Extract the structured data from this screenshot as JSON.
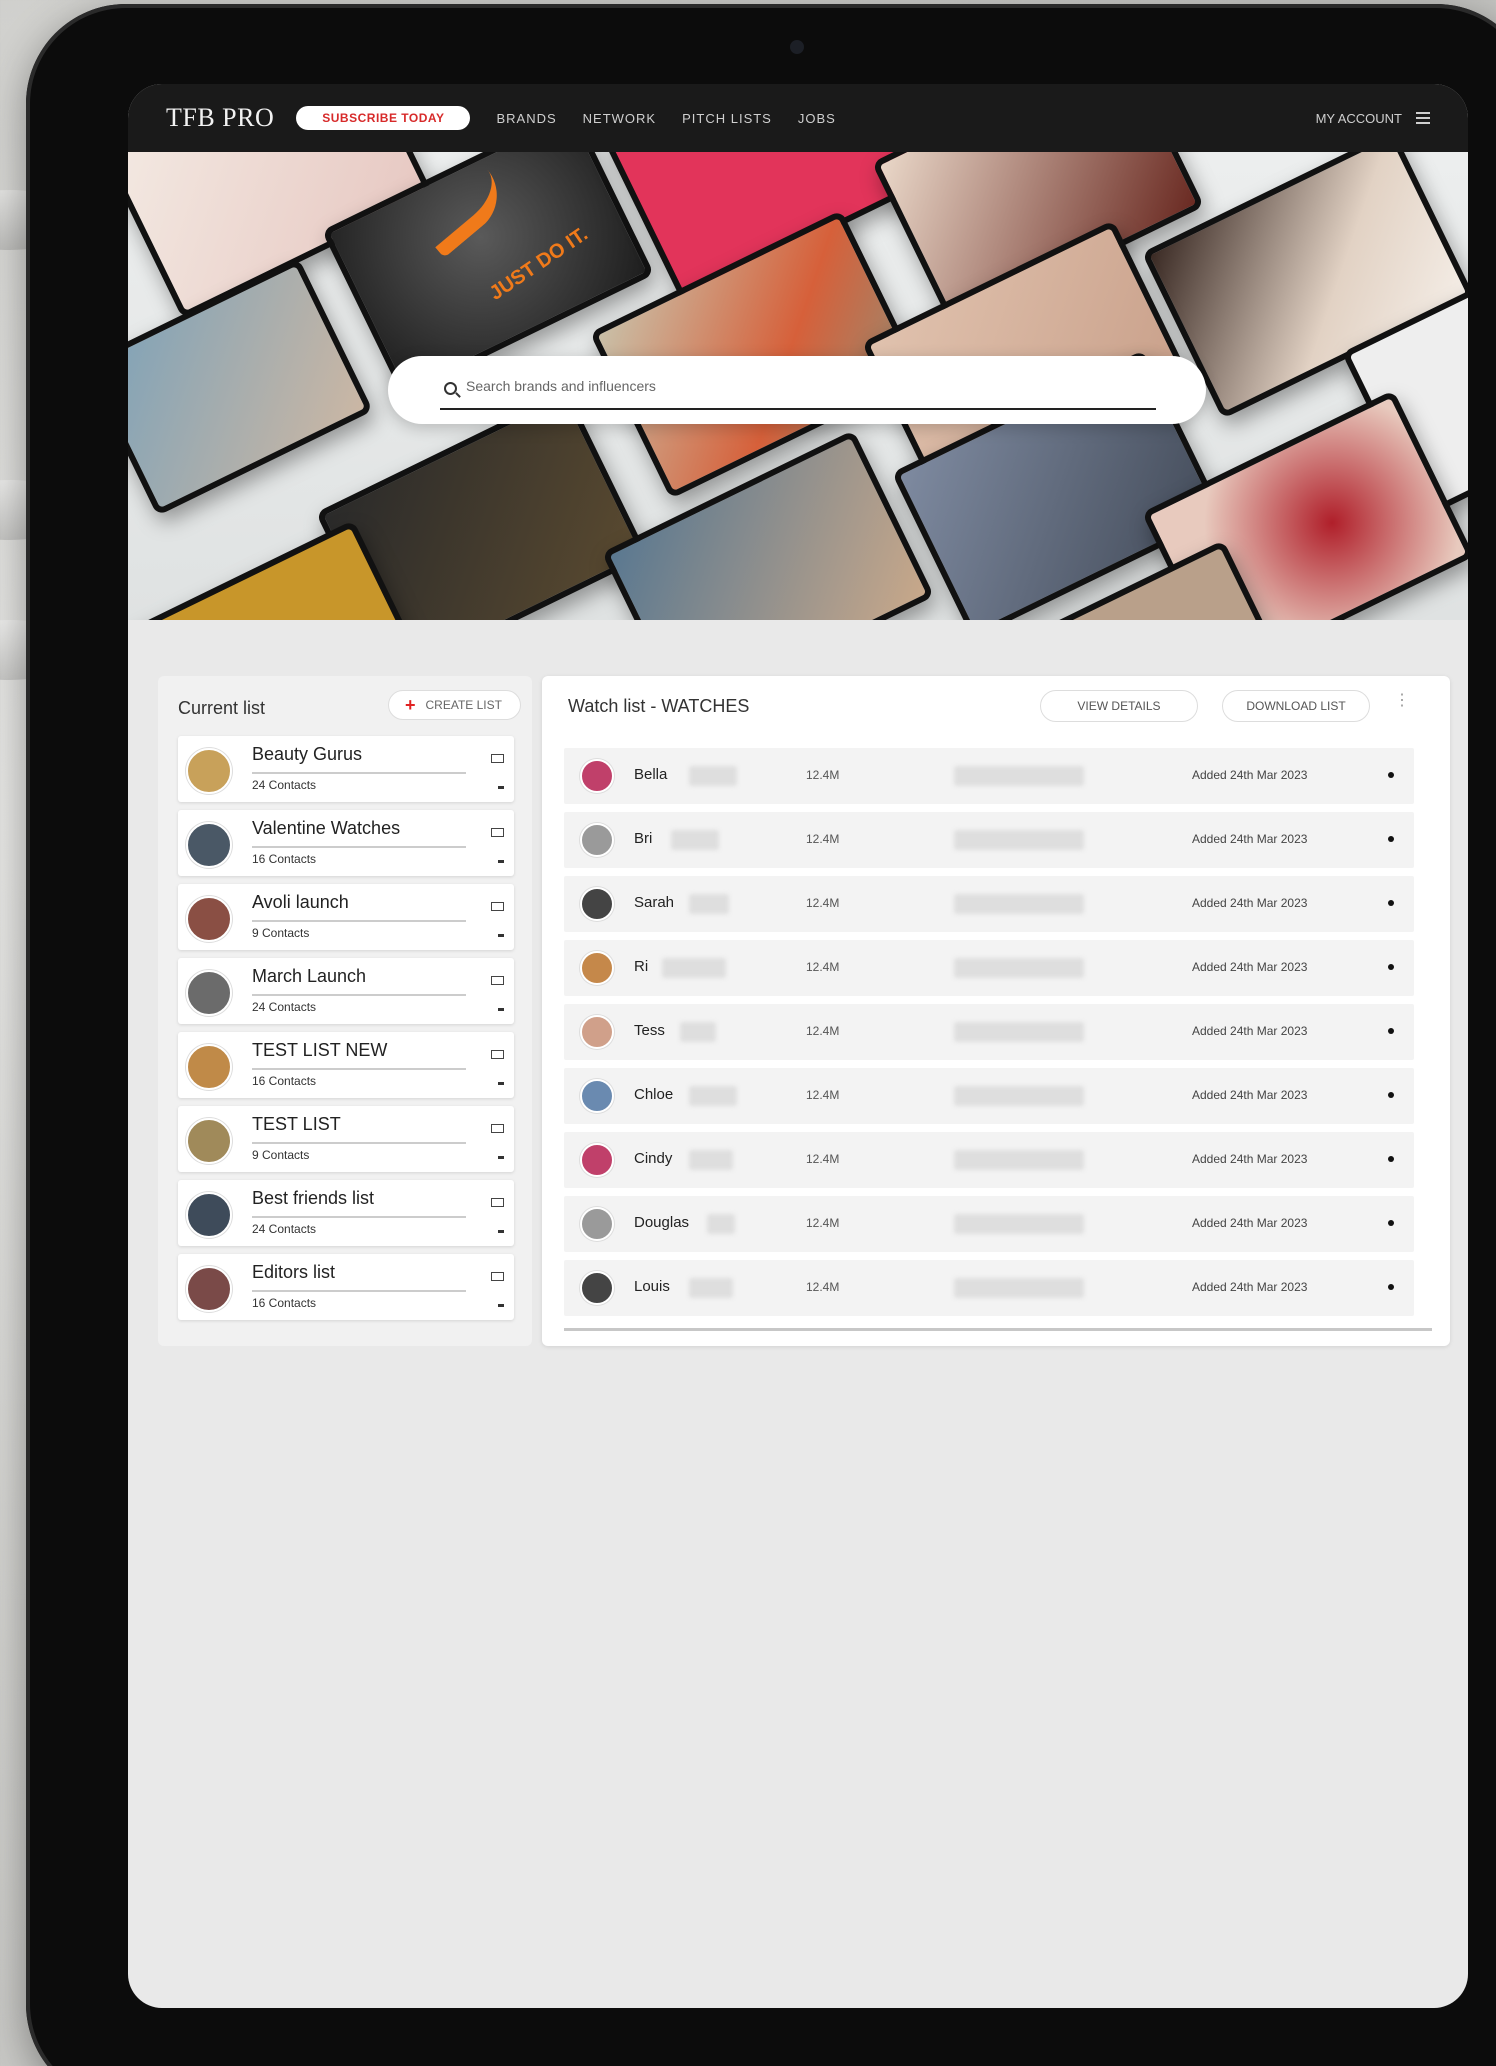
{
  "nav": {
    "logo": "TFB PRO",
    "subscribe_label": "SUBSCRIBE TODAY",
    "links": [
      "BRANDS",
      "NETWORK",
      "PITCH LISTS",
      "JOBS"
    ],
    "account_label": "MY ACCOUNT"
  },
  "search": {
    "placeholder": "Search brands and influencers"
  },
  "left_panel": {
    "title": "Current list",
    "create_label": "CREATE LIST",
    "lists": [
      {
        "name": "Beauty Gurus",
        "subtitle": "24 Contacts",
        "avatar_color": "#c8a15a"
      },
      {
        "name": "Valentine Watches",
        "subtitle": "16 Contacts",
        "avatar_color": "#4a5866"
      },
      {
        "name": "Avoli launch",
        "subtitle": "9 Contacts",
        "avatar_color": "#8a4f44"
      },
      {
        "name": "March Launch",
        "subtitle": "24 Contacts",
        "avatar_color": "#6b6b6b"
      },
      {
        "name": "TEST LIST NEW",
        "subtitle": "16 Contacts",
        "avatar_color": "#c08a48"
      },
      {
        "name": "TEST LIST",
        "subtitle": "9 Contacts",
        "avatar_color": "#a08a5a"
      },
      {
        "name": "Best friends list",
        "subtitle": "24 Contacts",
        "avatar_color": "#3e4b5a"
      },
      {
        "name": "Editors list",
        "subtitle": "16 Contacts",
        "avatar_color": "#7a4a48"
      }
    ]
  },
  "right_panel": {
    "title": "Watch list - WATCHES",
    "btn_1_label": "VIEW DETAILS",
    "btn_2_label": "DOWNLOAD LIST",
    "more_icon": "more-icon",
    "rows": [
      {
        "name": "Bella",
        "count": "12.4M",
        "date": "Added 24th Mar 2023",
        "avatar_color": "#c0406a",
        "blur_w": 48
      },
      {
        "name": "Bri",
        "count": "12.4M",
        "date": "Added 24th Mar 2023",
        "avatar_color": "#9a9a9a",
        "blur_w": 48
      },
      {
        "name": "Sarah",
        "count": "12.4M",
        "date": "Added 24th Mar 2023",
        "avatar_color": "#444",
        "blur_w": 40
      },
      {
        "name": "Ri",
        "count": "12.4M",
        "date": "Added 24th Mar 2023",
        "avatar_color": "#c5884a",
        "blur_w": 64
      },
      {
        "name": "Tess",
        "count": "12.4M",
        "date": "Added 24th Mar 2023",
        "avatar_color": "#d0a08a",
        "blur_w": 36
      },
      {
        "name": "Chloe",
        "count": "12.4M",
        "date": "Added 24th Mar 2023",
        "avatar_color": "#6a8ab0",
        "blur_w": 48
      },
      {
        "name": "Cindy",
        "count": "12.4M",
        "date": "Added 24th Mar 2023",
        "avatar_color": "#c0406a",
        "blur_w": 44
      },
      {
        "name": "Douglas",
        "count": "12.4M",
        "date": "Added 24th Mar 2023",
        "avatar_color": "#9a9a9a",
        "blur_w": 28
      },
      {
        "name": "Louis",
        "count": "12.4M",
        "date": "Added 24th Mar 2023",
        "avatar_color": "#444",
        "blur_w": 44
      }
    ]
  },
  "colors": {
    "nav_bg": "#1a1a1a",
    "accent_red": "#d72a2a",
    "screen_bg": "#e9e9e9"
  },
  "hero": {
    "tile_text": "JUST DO IT."
  }
}
